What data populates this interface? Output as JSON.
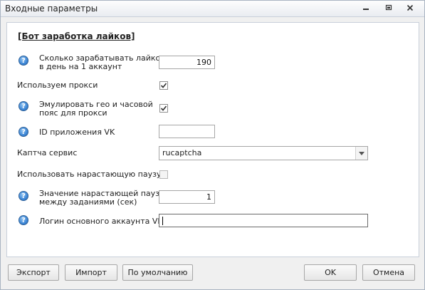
{
  "window": {
    "title": "Входные параметры"
  },
  "heading": "[Бот заработка лайков]",
  "fields": {
    "likes_per_day": {
      "label_line1": "Сколько зарабатывать лайков",
      "label_line2": "в день на 1 аккаунт",
      "value": "190"
    },
    "use_proxy": {
      "label": "Используем прокси",
      "checked": true
    },
    "emulate_geo": {
      "label_line1": "Эмулировать гео и часовой",
      "label_line2": "пояс для прокси",
      "checked": true
    },
    "vk_app_id": {
      "label": "ID приложения VK",
      "value": ""
    },
    "captcha": {
      "label": "Каптча сервис",
      "value": "rucaptcha"
    },
    "increasing_pause": {
      "label": "Использовать нарастающую паузу",
      "checked": false
    },
    "pause_value": {
      "label_line1": "Значение нарастающей паузы",
      "label_line2": "между заданиями (сек)",
      "value": "1"
    },
    "vk_login": {
      "label": "Логин основного аккаунта VK",
      "value": ""
    }
  },
  "buttons": {
    "export": "Экспорт",
    "import": "Импорт",
    "default": "По умолчанию",
    "ok": "OK",
    "cancel": "Отмена"
  },
  "icons": {
    "help": "question-circle-icon",
    "minimize": "minimize-icon",
    "restore": "restore-icon",
    "close": "close-icon",
    "check": "checkmark-icon",
    "dropdown": "chevron-down-icon"
  }
}
